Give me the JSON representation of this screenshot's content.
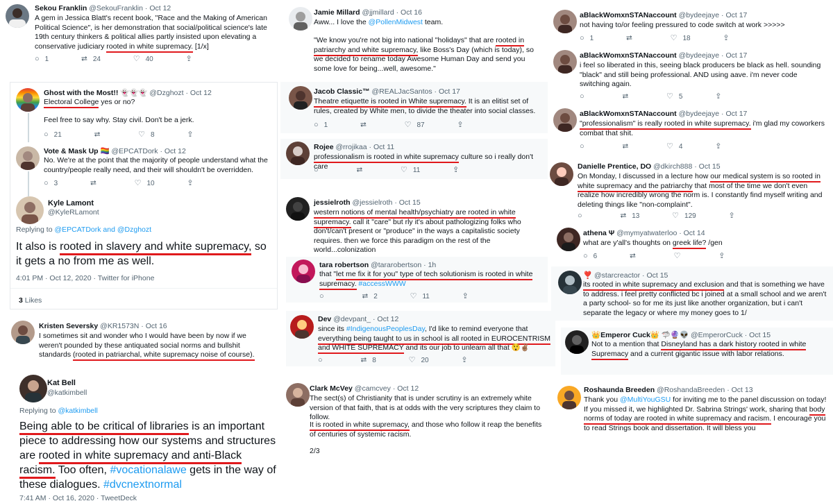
{
  "tweets": {
    "sekou": {
      "name": "Sekou Franklin",
      "handle": "@SekouFranklin",
      "date": "Oct 12",
      "text_1": "A gem in Jessica Blatt's recent book, \"Race and the Making of American Political Science\", is her demonstration that social/political science's late 19th century thinkers & political allies partly insisted upon elevating a conservative judiciary ",
      "text_u": "rooted in white supremacy.",
      "text_2": " [1/x]",
      "replies": "1",
      "retweets": "24",
      "likes": "40"
    },
    "ghost": {
      "name": "Ghost with the Most!! 👻👻👻",
      "handle": "@Dzghozt",
      "date": "Oct 12",
      "text_u": "Electoral College",
      "text_2": " yes or no?",
      "text_3": "Feel free to say why. Stay civil. Don't be a jerk.",
      "replies": "21",
      "retweets": "",
      "likes": "8"
    },
    "vote": {
      "name": "Vote & Mask Up 🏳️‍🌈",
      "handle": "@EPCATDork",
      "date": "Oct 12",
      "text": "No. We're at the point that the majority of people understand what the country/people really need, and their will shouldn't be overridden.",
      "replies": "3",
      "retweets": "",
      "likes": "10"
    },
    "kyle": {
      "name": "Kyle Lamont",
      "handle": "@KyleRLamont",
      "replying_prefix": "Replying to ",
      "replying_to": "@EPCATDork and @Dzghozt",
      "text_1": "It also is ",
      "text_u": "rooted in slavery and white supremacy,",
      "text_2": " so it gets a no from me as well.",
      "meta": "4:01 PM · Oct 12, 2020 · Twitter for iPhone",
      "likes_count": "3",
      "likes_label": "Likes"
    },
    "kristen": {
      "name": "Kristen Seversky",
      "handle": "@KR1573N",
      "date": "Oct 16",
      "text_1": "I sometimes sit and wonder who I would have been by now if we weren't pounded by these antiquated social norms and bullshit standards ",
      "text_u": "(rooted in patriarchal, white supremacy noise of course)."
    },
    "kat": {
      "name": "Kat Bell",
      "handle": "@katkimbell",
      "replying_prefix": "Replying to ",
      "replying_to": "@katkimbell",
      "text_u1": "Being able to be critical of libraries",
      "text_1": " is an important piece to addressing how our systems and structures are ",
      "text_u2": "rooted in white supremacy and anti-Black racism.",
      "text_2": " Too often, ",
      "tag_1": "#vocationalawe",
      "text_3": " gets in the way of these dialogues. ",
      "tag_2": "#dvcnextnormal",
      "meta": "7:41 AM · Oct 16, 2020 · TweetDeck"
    },
    "jamie": {
      "name": "Jamie Millard",
      "handle": "@jjmillard",
      "date": "Oct 16",
      "text_0a": "Aww... I love the ",
      "text_0link": "@PollenMidwest",
      "text_0b": " team.",
      "text_1": "\"We know you're not big into national \"holidays\" that are ",
      "text_u": "rooted in patriarchy and white supremacy,",
      "text_2": " like Boss's Day (which is today), so we decided to rename today Awesome Human Day and send you some love for being...well, awesome.\""
    },
    "jacob": {
      "name": "Jacob Classic™",
      "handle": "@REALJacSantos",
      "date": "Oct 17",
      "text_u": "Theatre etiquette is rooted in White supremacy.",
      "text_2": " It is an elitist set of rules, created by White men, to divide the theater into social classes.",
      "replies": "1",
      "retweets": "",
      "likes": "87"
    },
    "rojee": {
      "name": "Rojee",
      "handle": "@rrojikaa",
      "date": "Oct 11",
      "text_u": "professionalism is rooted in white supremacy",
      "text_2": " culture so i really don't care",
      "replies": "",
      "retweets": "",
      "likes": "11"
    },
    "jessie": {
      "name": "jessielroth",
      "handle": "@jessielroth",
      "date": "Oct 15",
      "text_u": "western notions of mental health/psychiatry are rooted in white supremacy.",
      "text_2": " call it \"care\" but rly it's about pathologizing folks who don't/can't present or \"produce\" in the ways a capitalistic society requires. then we force this paradigm on the rest of the world...colonization"
    },
    "tara": {
      "name": "tara robertson",
      "handle": "@tararobertson",
      "date": "1h",
      "text_1": "that \"",
      "text_u": "let me fix it for you\" type of tech solutionism is rooted in white supremacy.",
      "text_2": " ",
      "tag": "#accessWWW",
      "replies": "",
      "retweets": "2",
      "likes": "11"
    },
    "dev": {
      "name": "Dev",
      "handle": "@devpant_",
      "date": "Oct 12",
      "text_1": "since its ",
      "tag": "#IndigenousPeoplesDay",
      "text_2": ", I'd like to remind everyone that ",
      "text_u": "everything being taught to us in school is all rooted in EUROCENTRISM and WHITE SUPREMACY",
      "text_3": " and its our job to unlearn all that 😲✌🏽",
      "replies": "",
      "retweets": "8",
      "likes": "20"
    },
    "clark": {
      "name": "Clark McVey",
      "handle": "@camcvey",
      "date": "Oct 12",
      "text_1": "The sect(s) of Christianity that is under scrutiny is an extremely white version of that faith, that is at odds with the very scriptures they claim to follow.",
      "text_u": "It is rooted in white supremacy,",
      "text_2": " and those who follow it reap the benefits of centuries of systemic racism.",
      "count": "2/3"
    },
    "ablack1": {
      "name": "aBlackWomxnSTANaccount",
      "handle": "@bydeejaye",
      "date": "Oct 17",
      "text": "not having to/or feeling pressured to code switch at work >>>>>",
      "replies": "1",
      "retweets": "",
      "likes": "18"
    },
    "ablack2": {
      "name": "aBlackWomxnSTANaccount",
      "handle": "@bydeejaye",
      "date": "Oct 17",
      "text": "i feel so liberated in this, seeing black producers be black as hell. sounding \"black\" and still being professional. AND using aave. i'm never code switching again.",
      "replies": "",
      "retweets": "",
      "likes": "5"
    },
    "ablack3": {
      "name": "aBlackWomxnSTANaccount",
      "handle": "@bydeejaye",
      "date": "Oct 17",
      "text_u": "\"professionalism\" is really rooted in white supremacy.",
      "text_2": " i'm glad my coworkers combat that shit.",
      "replies": "",
      "retweets": "",
      "likes": "4"
    },
    "danielle": {
      "name": "Danielle Prentice, DO",
      "handle": "@dkirch888",
      "date": "Oct 15",
      "text_1": "On Monday, I discussed in a lecture how ",
      "text_u": "our medical system is so rooted in white supremacy and the patriarchy",
      "text_2": " that most of the time we don't even realize how incredibly wrong the norm is. I constantly find myself writing and deleting things like \"non-complaint\".",
      "replies": "",
      "retweets": "13",
      "likes": "129"
    },
    "athena": {
      "name": "athena Ψ",
      "handle": "@mymyatwaterloo",
      "date": "Oct 14",
      "text_1": "what are y'all's thoughts on ",
      "text_u": "greek life?",
      "text_2": " /gen",
      "replies": "6",
      "retweets": "",
      "likes": ""
    },
    "star": {
      "name": "❣️",
      "handle": "@starcreactor",
      "date": "Oct 15",
      "text_u": "its rooted in white supremacy and exclusion",
      "text_2": " and that is something we have to address. i feel pretty conflicted bc i joined at a small school and we aren't a party school- so for me its just like another organization, but i can't separate the legacy or where my money goes to 1/"
    },
    "emperor": {
      "name": "👑Emperor Cuck👑 🦈🔮👽",
      "handle": "@EmperorCuck",
      "date": "Oct 15",
      "text_1": "Not to a mention that ",
      "text_u": "Disneyland has a dark history rooted in white Supremacy",
      "text_2": " and a current gigantic issue with labor relations."
    },
    "roshaunda": {
      "name": "Roshaunda Breeden",
      "handle": "@RoshandaBreeden",
      "date": "Oct 13",
      "text_1": "Thank you ",
      "link": "@MultiYouGSU",
      "text_2": " for inviting me to the panel discussion on today! If you missed it, we highlighted Dr. Sabrina Strings' work, sharing that ",
      "text_u": "body norms of today are rooted in white supremacy and racism.",
      "text_3": " I encourage you to read Strings book and dissertation. It will bless you"
    }
  },
  "icons": {
    "reply": "💬",
    "retweet": "⮂",
    "like": "♡",
    "share": "⇪"
  },
  "colors": {
    "underline": "#e0191c",
    "link": "#1d9bf0",
    "muted": "#536471",
    "border": "#d8dde2"
  }
}
